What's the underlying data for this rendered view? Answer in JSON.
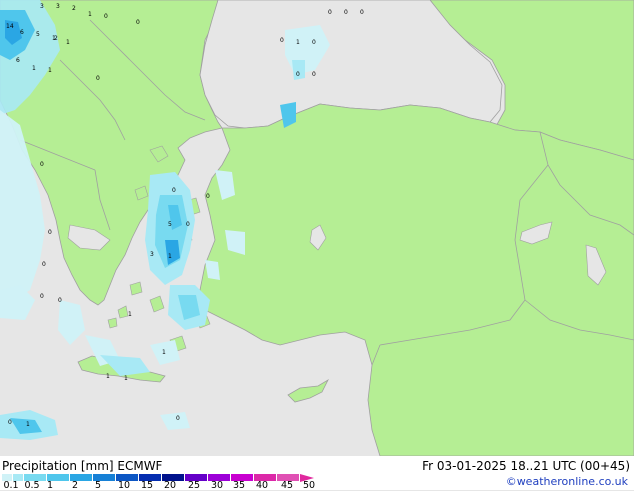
{
  "header": {
    "product_label": "Precipitation [mm] ECMWF",
    "valid_time": "Fr 03-01-2025 18..21 UTC (00+45)"
  },
  "credit": "©weatheronline.co.uk",
  "legend": {
    "ticks": [
      "0.1",
      "0.5",
      "1",
      "2",
      "5",
      "10",
      "15",
      "20",
      "25",
      "30",
      "35",
      "40",
      "45",
      "50"
    ],
    "colors": [
      "#d0f2f7",
      "#a8e9f5",
      "#78daf0",
      "#4fc6ec",
      "#2aa6e4",
      "#1680d6",
      "#0c56c4",
      "#052db0",
      "#00128c",
      "#6400c8",
      "#9c00d8",
      "#c800d0",
      "#dc28a8",
      "#e050b4"
    ]
  },
  "colors": {
    "sea": "#e6e6e6",
    "land": "#b5ee94",
    "border": "#a0a0a0",
    "credit_text": "#1f3fbf"
  },
  "map_values": [
    "14",
    "3",
    "2",
    "1",
    "0",
    "6",
    "5",
    "0",
    "0",
    "0",
    "0",
    "1",
    "0",
    "0",
    "0",
    "0",
    "1",
    "2",
    "1",
    "6",
    "1",
    "1",
    "3",
    "0",
    "5",
    "0",
    "3",
    "1",
    "0",
    "0",
    "0",
    "0",
    "0",
    "0",
    "0",
    "1",
    "1",
    "1",
    "1",
    "0",
    "0",
    "1"
  ]
}
